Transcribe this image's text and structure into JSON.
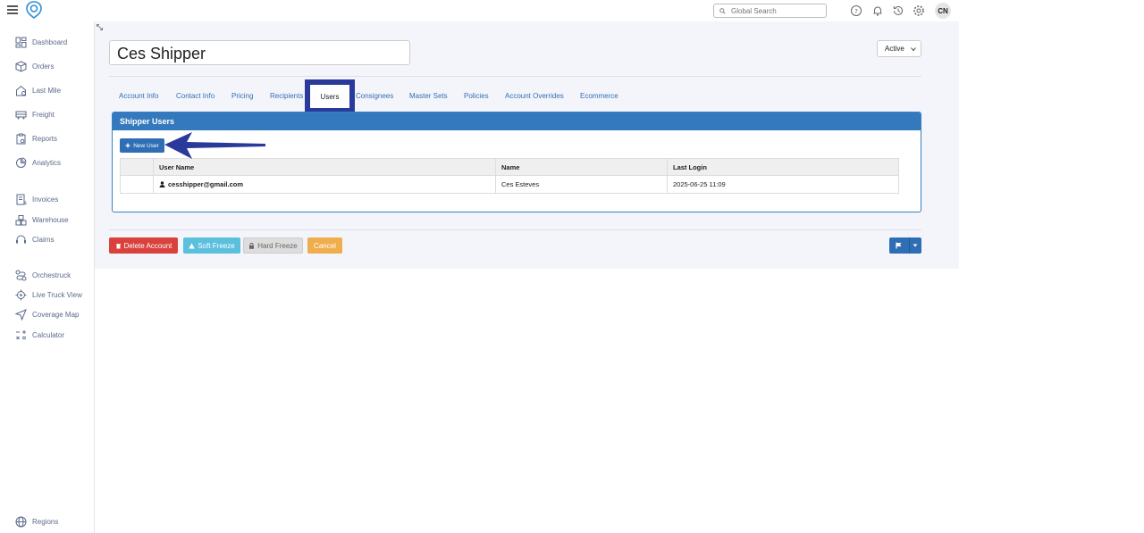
{
  "header": {
    "search_placeholder": "Global Search",
    "avatar_initials": "CN",
    "icons": [
      "help-icon",
      "bell-icon",
      "history-icon",
      "gear-icon"
    ]
  },
  "sidebar": {
    "items": [
      {
        "label": "Dashboard",
        "icon": "dashboard-icon"
      },
      {
        "label": "Orders",
        "icon": "box-icon"
      },
      {
        "label": "Last Mile",
        "icon": "house-icon"
      },
      {
        "label": "Freight",
        "icon": "truck-icon"
      },
      {
        "label": "Reports",
        "icon": "clipboard-icon"
      },
      {
        "label": "Analytics",
        "icon": "analytics-icon"
      },
      {
        "label": "Invoices",
        "icon": "invoice-icon"
      },
      {
        "label": "Warehouse",
        "icon": "warehouse-icon"
      },
      {
        "label": "Claims",
        "icon": "headset-icon"
      },
      {
        "label": "Orchestruck",
        "icon": "route-icon"
      },
      {
        "label": "Live Truck View",
        "icon": "target-icon"
      },
      {
        "label": "Coverage Map",
        "icon": "navigation-icon"
      },
      {
        "label": "Calculator",
        "icon": "calculator-icon"
      },
      {
        "label": "Regions",
        "icon": "globe-icon"
      }
    ]
  },
  "account": {
    "name": "Ces Shipper",
    "status": "Active"
  },
  "tabs": [
    {
      "label": "Account Info"
    },
    {
      "label": "Contact Info"
    },
    {
      "label": "Pricing"
    },
    {
      "label": "Recipients"
    },
    {
      "label": "Users",
      "active": true
    },
    {
      "label": "Consignees"
    },
    {
      "label": "Master Sets"
    },
    {
      "label": "Policies"
    },
    {
      "label": "Account Overrides"
    },
    {
      "label": "Ecommerce"
    }
  ],
  "panel": {
    "title": "Shipper Users",
    "new_user_label": "New User",
    "columns": [
      "User Name",
      "Name",
      "Last Login"
    ],
    "rows": [
      {
        "username": "cesshipper@gmail.com",
        "name": "Ces Esteves",
        "last_login": "2025-06-25 11:09"
      }
    ]
  },
  "footer": {
    "delete_label": "Delete Account",
    "soft_freeze_label": "Soft Freeze",
    "hard_freeze_label": "Hard Freeze",
    "cancel_label": "Cancel"
  },
  "colors": {
    "primary": "#2f6eb5",
    "danger": "#d9423c",
    "info": "#5bc0de",
    "warning": "#f0ad4e",
    "annotation": "#2a3a9a"
  }
}
